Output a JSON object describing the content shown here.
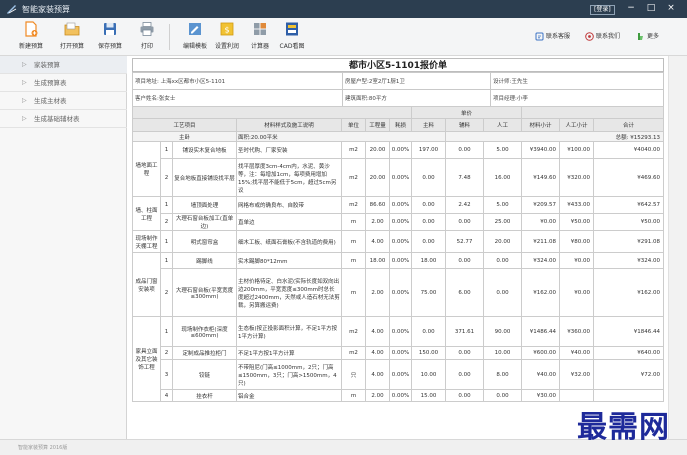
{
  "window": {
    "title": "智能家装预算",
    "login_label": "[登录]",
    "minimize_glyph": "−",
    "maximize_glyph": "□",
    "close_glyph": "×"
  },
  "toolbar": {
    "buttons": [
      {
        "label": "新建预算",
        "icon": "new-file-icon",
        "color": "#f08a24"
      },
      {
        "label": "打开预算",
        "icon": "open-folder-icon",
        "color": "#e0a03a"
      },
      {
        "label": "保存预算",
        "icon": "save-disk-icon",
        "color": "#3a6fb5"
      },
      {
        "label": "打印",
        "icon": "printer-icon",
        "color": "#7a8a99"
      },
      {
        "label": "编辑模板",
        "icon": "edit-template-icon",
        "color": "#4a88c8"
      },
      {
        "label": "设置利润",
        "icon": "profit-settings-icon",
        "color": "#e7b52c"
      },
      {
        "label": "计算器",
        "icon": "calculator-icon",
        "color": "#8f9ca8"
      },
      {
        "label": "CAD看图",
        "icon": "cad-viewer-icon",
        "color": "#2f5fa8"
      }
    ],
    "right_links": [
      {
        "label": "联系客服",
        "icon": "customer-service-icon",
        "color": "#3b72c4"
      },
      {
        "label": "联系我们",
        "icon": "contact-icon",
        "color": "#c0393b"
      },
      {
        "label": "更多",
        "icon": "more-icon",
        "color": "#3f9b3f"
      }
    ]
  },
  "sidebar": {
    "items": [
      {
        "label": "家装预算"
      },
      {
        "label": "生成预算表"
      },
      {
        "label": "生成主材表"
      },
      {
        "label": "生成基础辅材表"
      }
    ]
  },
  "report": {
    "title": "都市小区5-1101报价单",
    "info": {
      "address": "项目地址: 上海xx区都市小区5-1101",
      "layout": "房屋户型:2室2厅1厨1卫",
      "designer": "设计师:王先生",
      "client": "客户姓名:张女士",
      "area": "建筑面积:80平方",
      "manager": "项目经理:小李"
    },
    "headers": {
      "price_group": "单价",
      "item": "工艺项目",
      "material": "材料样式及施工说明",
      "unit": "单位",
      "quantity": "工程量",
      "loss": "耗损",
      "main_material": "主料",
      "aux_material": "辅料",
      "labor": "人工",
      "material_subtotal": "材料小计",
      "labor_subtotal": "人工小计",
      "total": "合计"
    },
    "subheader": {
      "room": "主卧",
      "area": "面积:20.00平米",
      "sum": "总额: ¥15293.13"
    },
    "rows": [
      {
        "cat": "墙地面工程",
        "no": "1",
        "item": "铺设实木复合地板",
        "desc": "圣时代购、厂家安装",
        "unit": "m2",
        "qty": "20.00",
        "loss": "0.00%",
        "main": "197.00",
        "aux": "0.00",
        "labor": "5.00",
        "msub": "¥3940.00",
        "lsub": "¥100.00",
        "total": "¥4040.00"
      },
      {
        "cat": "",
        "no": "2",
        "item": "复合地板直接铺设找平层",
        "desc": "找平层厚度3cm-4cm内，水泥、黄沙等，注：每增加1cm，每项费用增加15%;找平层不能低于5cm，超过5cm另议",
        "unit": "m2",
        "qty": "20.00",
        "loss": "0.00%",
        "main": "0.00",
        "aux": "7.48",
        "labor": "16.00",
        "msub": "¥149.60",
        "lsub": "¥320.00",
        "total": "¥469.60"
      },
      {
        "cat": "墙、柱面工程",
        "no": "1",
        "item": "墙顶面处理",
        "desc": "网格布或的确良布、自胶带",
        "unit": "m2",
        "qty": "86.60",
        "loss": "0.00%",
        "main": "0.00",
        "aux": "2.42",
        "labor": "5.00",
        "msub": "¥209.57",
        "lsub": "¥433.00",
        "total": "¥642.57"
      },
      {
        "cat": "",
        "no": "2",
        "item": "大理石窗台板加工(直单边)",
        "desc": "直单边",
        "unit": "m",
        "qty": "2.00",
        "loss": "0.00%",
        "main": "0.00",
        "aux": "0.00",
        "labor": "25.00",
        "msub": "¥0.00",
        "lsub": "¥50.00",
        "total": "¥50.00"
      },
      {
        "cat": "现场制作天棚工程",
        "no": "1",
        "item": "明式窗帘盒",
        "desc": "细木工板、纸面石膏板(不含轨道的费用)",
        "unit": "m",
        "qty": "4.00",
        "loss": "0.00%",
        "main": "0.00",
        "aux": "52.77",
        "labor": "20.00",
        "msub": "¥211.08",
        "lsub": "¥80.00",
        "total": "¥291.08"
      },
      {
        "cat": "成品门窗安装项",
        "no": "1",
        "item": "踢脚线",
        "desc": "实木踢脚80*12mm",
        "unit": "m",
        "qty": "18.00",
        "loss": "0.00%",
        "main": "18.00",
        "aux": "0.00",
        "labor": "0.00",
        "msub": "¥324.00",
        "lsub": "¥0.00",
        "total": "¥324.00"
      },
      {
        "cat": "",
        "no": "2",
        "item": "大理石窗台板(平宽宽度≤300mm)",
        "desc": "主材价格待定、白水泥(实际长度如双向出边200mm，平宽宽度≤300mm时总长度超过2400mm，天然或人造石材无法剪裁，另算搬运费)",
        "unit": "m",
        "qty": "2.00",
        "loss": "0.00%",
        "main": "75.00",
        "aux": "6.00",
        "labor": "0.00",
        "msub": "¥162.00",
        "lsub": "¥0.00",
        "total": "¥162.00"
      },
      {
        "cat": "家具立面及其它装饰工程",
        "no": "1",
        "item": "现场制作衣柜(深度≤600mm)",
        "desc": "生态板(按正投影面积计算，不足1平方按1平方计算)",
        "unit": "m2",
        "qty": "4.00",
        "loss": "0.00%",
        "main": "0.00",
        "aux": "371.61",
        "labor": "90.00",
        "msub": "¥1486.44",
        "lsub": "¥360.00",
        "total": "¥1846.44"
      },
      {
        "cat": "",
        "no": "2",
        "item": "定制成品推拉柜门",
        "desc": "不足1平方按1平方计算",
        "unit": "m2",
        "qty": "4.00",
        "loss": "0.00%",
        "main": "150.00",
        "aux": "0.00",
        "labor": "10.00",
        "msub": "¥600.00",
        "lsub": "¥40.00",
        "total": "¥640.00"
      },
      {
        "cat": "",
        "no": "3",
        "item": "铰链",
        "desc": "不带阻尼(门高≤1000mm，2只；门高≤1500mm，3只；门高>1500mm，4只)",
        "unit": "只",
        "qty": "4.00",
        "loss": "0.00%",
        "main": "10.00",
        "aux": "0.00",
        "labor": "8.00",
        "msub": "¥40.00",
        "lsub": "¥32.00",
        "total": "¥72.00"
      },
      {
        "cat": "",
        "no": "4",
        "item": "挂衣杆",
        "desc": "铝合金",
        "unit": "m",
        "qty": "2.00",
        "loss": "0.00%",
        "main": "15.00",
        "aux": "0.00",
        "labor": "0.00",
        "msub": "¥30.00",
        "lsub": "",
        "total": ""
      }
    ]
  },
  "statusbar": {
    "text": "智能家装预算 2016版"
  },
  "watermark": {
    "text": "最需网"
  },
  "colors": {
    "titlebar": "#2c3e50",
    "toolbar_bg": "#f4f5f6",
    "header_gray": "#e7e7e7",
    "watermark": "#1e2a9a"
  }
}
